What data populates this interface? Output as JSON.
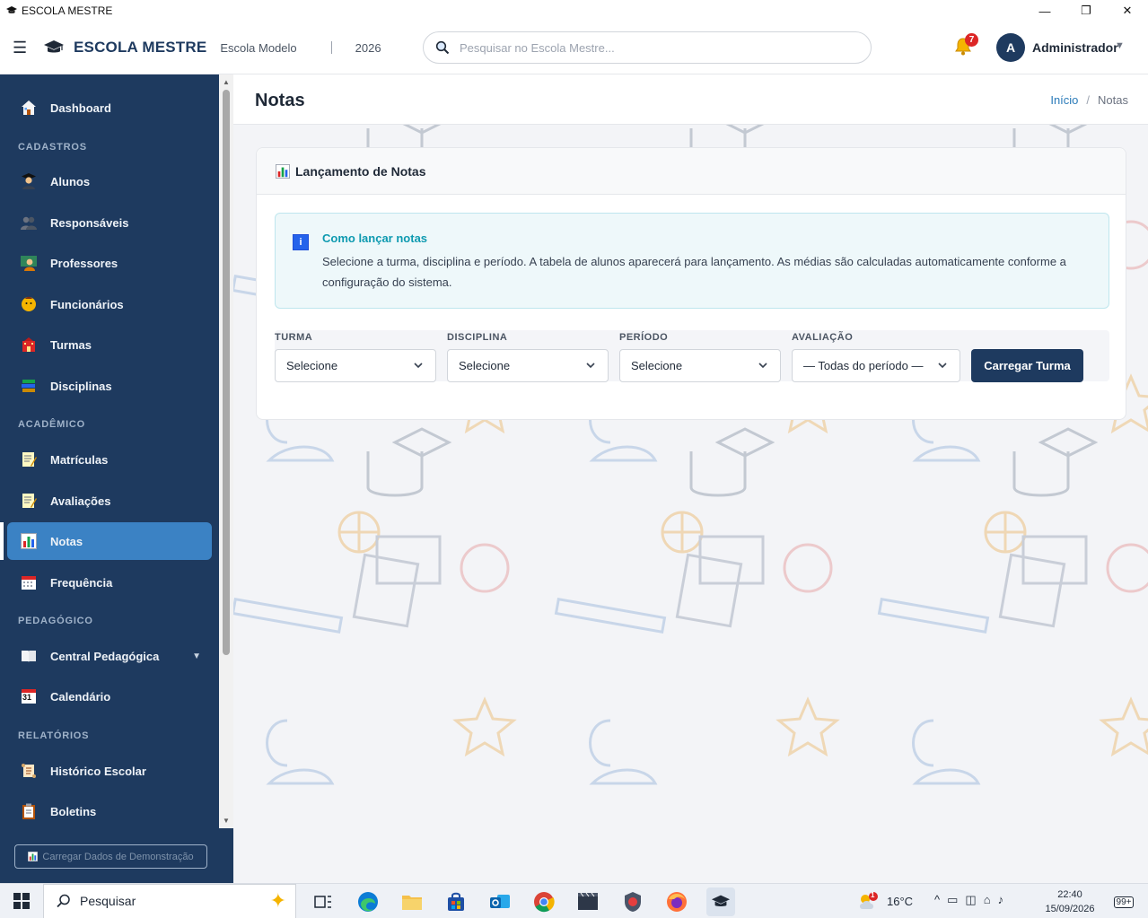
{
  "window": {
    "title": "ESCOLA MESTRE",
    "controls": {
      "minimize": "—",
      "maximize": "❐",
      "close": "✕"
    }
  },
  "header": {
    "menu_icon": "☰",
    "brand": "ESCOLA MESTRE",
    "school": "Escola Modelo",
    "separator": "|",
    "year": "2026",
    "search_placeholder": "Pesquisar no Escola Mestre...",
    "notifications_count": "7",
    "user_initial": "A",
    "user_name": "Administrador",
    "user_caret": "▼"
  },
  "sidebar": {
    "items": [
      {
        "label": "Dashboard",
        "icon": "home-icon"
      },
      {
        "label": "Alunos",
        "icon": "student-icon"
      },
      {
        "label": "Responsáveis",
        "icon": "guardians-icon"
      },
      {
        "label": "Professores",
        "icon": "teacher-icon"
      },
      {
        "label": "Funcionários",
        "icon": "staff-icon"
      },
      {
        "label": "Turmas",
        "icon": "school-icon"
      },
      {
        "label": "Disciplinas",
        "icon": "books-icon"
      },
      {
        "label": "Matrículas",
        "icon": "memo-icon"
      },
      {
        "label": "Avaliações",
        "icon": "memo-icon"
      },
      {
        "label": "Notas",
        "icon": "bar-chart-icon",
        "active": true
      },
      {
        "label": "Frequência",
        "icon": "calendar-icon"
      },
      {
        "label": "Central Pedagógica",
        "icon": "book-icon",
        "caret": "▼"
      },
      {
        "label": "Calendário",
        "icon": "calendar-31-icon",
        "icon_text": "31"
      },
      {
        "label": "Histórico Escolar",
        "icon": "scroll-icon"
      },
      {
        "label": "Boletins",
        "icon": "clipboard-icon"
      }
    ],
    "sections": {
      "cadastros": "CADASTROS",
      "academico": "ACADÊMICO",
      "pedagogico": "PEDAGÓGICO",
      "relatorios": "RELATÓRIOS"
    },
    "demo_button": "Carregar Dados de Demonstração"
  },
  "page": {
    "title": "Notas",
    "breadcrumb": {
      "home": "Início",
      "separator": "/",
      "current": "Notas"
    }
  },
  "card": {
    "title": "Lançamento de Notas",
    "info_icon": "i",
    "info_title": "Como lançar notas",
    "info_text": "Selecione a turma, disciplina e período. A tabela de alunos aparecerá para lançamento. As médias são calculadas automaticamente conforme a configuração do sistema."
  },
  "filters": {
    "turma": {
      "label": "TURMA",
      "value": "Selecione"
    },
    "disciplina": {
      "label": "DISCIPLINA",
      "value": "Selecione"
    },
    "periodo": {
      "label": "PERÍODO",
      "value": "Selecione"
    },
    "avaliacao": {
      "label": "AVALIAÇÃO",
      "value": "— Todas do período —"
    },
    "submit": "Carregar Turma"
  },
  "taskbar": {
    "search_label": "Pesquisar",
    "weather_badge": "1",
    "temperature": "16°C",
    "time": "22:40",
    "date": "15/09/2026",
    "notifications": "99+"
  },
  "colors": {
    "sidebar_bg": "#1e3a5f",
    "active_item": "#3b82c4",
    "primary_button": "#1e3a5f",
    "info_title": "#0e9ab0",
    "badge": "#dc2626"
  }
}
